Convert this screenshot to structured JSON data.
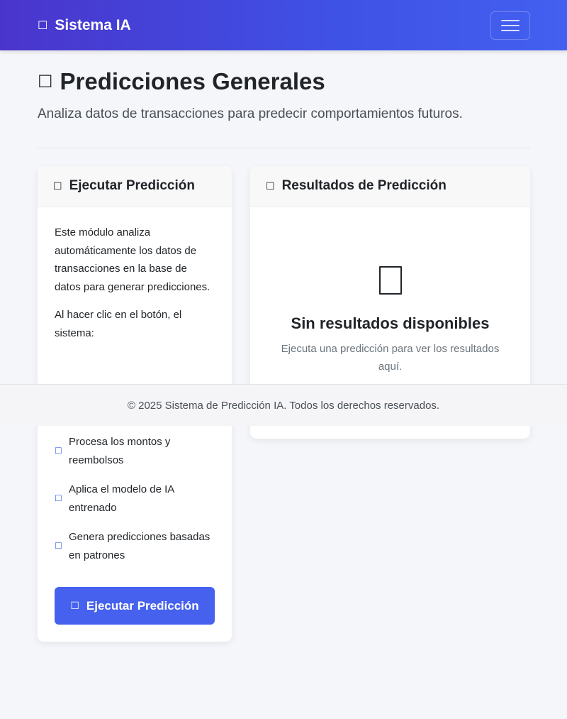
{
  "navbar": {
    "brand_icon": "robot-icon",
    "brand_glyph": "☐",
    "brand": "Sistema IA",
    "toggler_icon": "hamburger-menu-icon"
  },
  "header": {
    "title_icon": "chart-icon",
    "title_glyph": "☐",
    "title": "Predicciones Generales",
    "subtitle": "Analiza datos de transacciones para predecir comportamientos futuros."
  },
  "left_card": {
    "header_icon": "play-icon",
    "header_glyph": "☐",
    "header": "Ejecutar Predicción",
    "paragraph1": "Este módulo analiza automáticamente los datos de transacciones en la base de datos para generar predicciones.",
    "paragraph2": "Al hacer clic en el botón, el sistema:",
    "steps": [
      {
        "icon": "check-icon",
        "glyph": "☐",
        "label": "Procesa los montos y reembolsos"
      },
      {
        "icon": "check-icon",
        "glyph": "☐",
        "label": "Aplica el modelo de IA entrenado"
      },
      {
        "icon": "check-icon",
        "glyph": "☐",
        "label": "Genera predicciones basadas en patrones"
      }
    ],
    "button_icon": "play-icon",
    "button_glyph": "☐",
    "button_label": "Ejecutar Predicción"
  },
  "right_card": {
    "header_icon": "results-icon",
    "header_glyph": "☐",
    "header": "Resultados de Predicción",
    "empty_icon": "inbox-icon",
    "empty_title": "Sin resultados disponibles",
    "empty_text": "Ejecuta una predicción para ver los resultados aquí."
  },
  "footer": {
    "text": "© 2025 Sistema de Predicción IA. Todos los derechos reservados."
  },
  "colors": {
    "nav_gradient_start": "#4a35cc",
    "nav_gradient_end": "#4360f0",
    "primary_button": "#4661ee",
    "check_accent": "#3f63e8",
    "page_background": "#f5f6fa"
  }
}
